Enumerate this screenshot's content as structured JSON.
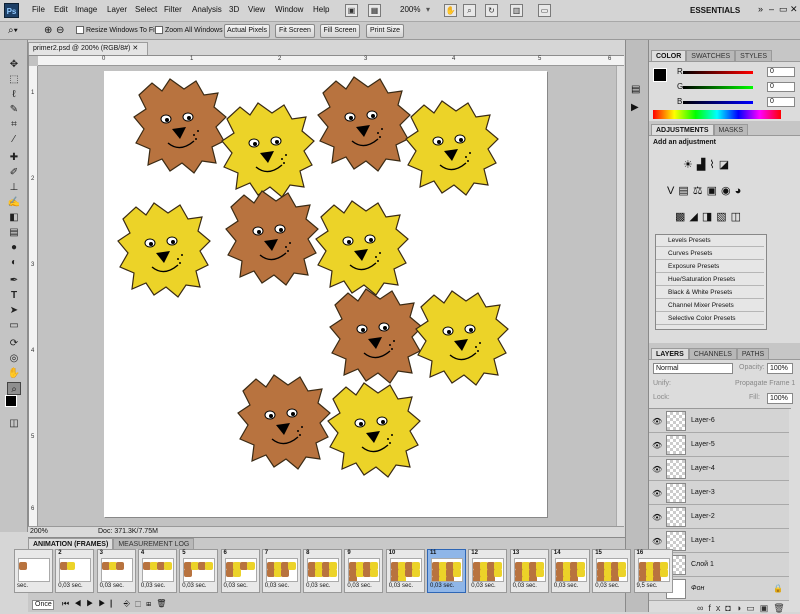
{
  "app": {
    "logo": "Ps"
  },
  "menubar": {
    "items": [
      "File",
      "Edit",
      "Image",
      "Layer",
      "Select",
      "Filter",
      "Analysis",
      "3D",
      "View",
      "Window",
      "Help"
    ],
    "zoom": "200%",
    "workspace": "ESSENTIALS"
  },
  "options": {
    "resize_windows": "Resize Windows To Fit",
    "zoom_all": "Zoom All Windows",
    "actual_pixels": "Actual Pixels",
    "fit_screen": "Fit Screen",
    "fill_screen": "Fill Screen",
    "print_size": "Print Size"
  },
  "document": {
    "tab": "primer2.psd @ 200% (RGB/8#)",
    "zoom": "200%",
    "doc_size": "Doc: 371.3K/7.75M",
    "ruler_h": [
      "0",
      "1",
      "2",
      "3",
      "4",
      "5",
      "6"
    ],
    "ruler_v": [
      "1",
      "2",
      "3",
      "4",
      "5",
      "6"
    ]
  },
  "color_panel": {
    "tabs": [
      "COLOR",
      "SWATCHES",
      "STYLES"
    ],
    "r": {
      "label": "R",
      "value": "0"
    },
    "g": {
      "label": "G",
      "value": "0"
    },
    "b": {
      "label": "B",
      "value": "0"
    }
  },
  "adjustments_panel": {
    "tabs": [
      "ADJUSTMENTS",
      "MASKS"
    ],
    "heading": "Add an adjustment",
    "presets": [
      "Levels Presets",
      "Curves Presets",
      "Exposure Presets",
      "Hue/Saturation Presets",
      "Black & White Presets",
      "Channel Mixer Presets",
      "Selective Color Presets"
    ]
  },
  "layers_panel": {
    "tabs": [
      "LAYERS",
      "CHANNELS",
      "PATHS"
    ],
    "blend_mode": "Normal",
    "opacity_label": "Opacity:",
    "opacity": "100%",
    "unify_label": "Unify:",
    "propagate": "Propagate Frame 1",
    "lock_label": "Lock:",
    "fill_label": "Fill:",
    "fill": "100%",
    "layers": [
      "Layer-6",
      "Layer-5",
      "Layer-4",
      "Layer-3",
      "Layer-2",
      "Layer-1",
      "Слой 1",
      "Фон"
    ]
  },
  "animation_panel": {
    "tabs": [
      "ANIMATION (FRAMES)",
      "MEASUREMENT LOG"
    ],
    "frames": [
      {
        "n": "",
        "d": "sec."
      },
      {
        "n": "2",
        "d": "0,03 sec."
      },
      {
        "n": "3",
        "d": "0,03 sec."
      },
      {
        "n": "4",
        "d": "0,03 sec."
      },
      {
        "n": "5",
        "d": "0,03 sec."
      },
      {
        "n": "6",
        "d": "0,03 sec."
      },
      {
        "n": "7",
        "d": "0,03 sec."
      },
      {
        "n": "8",
        "d": "0,03 sec."
      },
      {
        "n": "9",
        "d": "0,03 sec."
      },
      {
        "n": "10",
        "d": "0,03 sec."
      },
      {
        "n": "11",
        "d": "0,03 sec."
      },
      {
        "n": "12",
        "d": "0,03 sec."
      },
      {
        "n": "13",
        "d": "0,03 sec."
      },
      {
        "n": "14",
        "d": "0,03 sec."
      },
      {
        "n": "15",
        "d": "0,03 sec."
      },
      {
        "n": "16",
        "d": "9,5 sec."
      }
    ],
    "selected_frame": 10,
    "loop": "Once"
  },
  "colors": {
    "lion_brown": "#b8733f",
    "lion_yellow": "#ecd328",
    "selection": "#8fb6e8"
  }
}
